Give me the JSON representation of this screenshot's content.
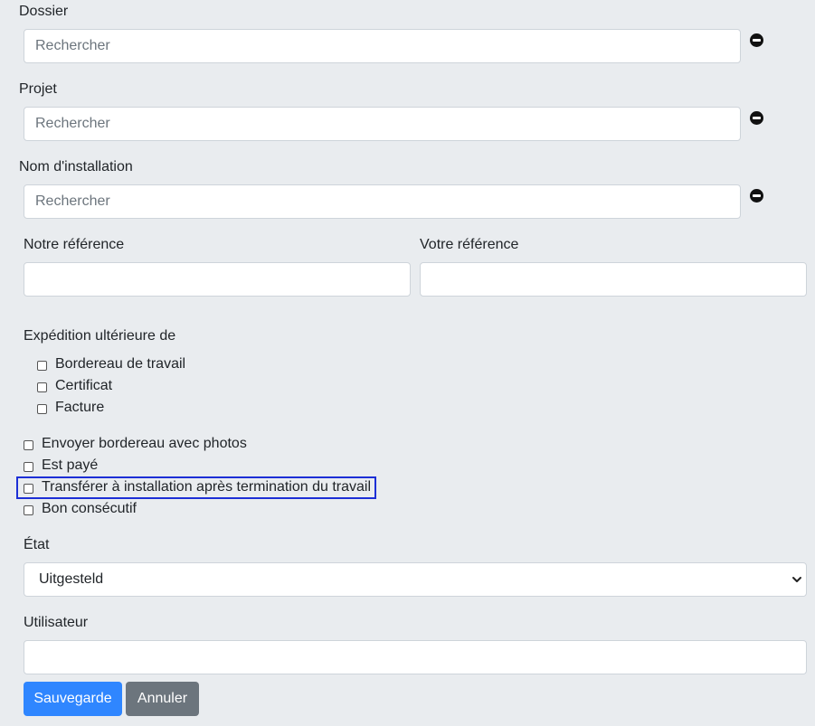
{
  "fields": {
    "dossier": {
      "label": "Dossier",
      "placeholder": "Rechercher"
    },
    "projet": {
      "label": "Projet",
      "placeholder": "Rechercher"
    },
    "installation": {
      "label": "Nom d'installation",
      "placeholder": "Rechercher"
    },
    "notre_ref": {
      "label": "Notre référence",
      "value": ""
    },
    "votre_ref": {
      "label": "Votre référence",
      "value": ""
    },
    "utilisateur": {
      "label": "Utilisateur",
      "value": ""
    }
  },
  "expedition": {
    "label": "Expédition ultérieure de",
    "options": [
      "Bordereau de travail",
      "Certificat",
      "Facture"
    ]
  },
  "checkboxes": [
    "Envoyer bordereau avec photos",
    "Est payé",
    "Transférer à installation après termination du travail",
    "Bon consécutif"
  ],
  "etat": {
    "label": "État",
    "selected": "Uitgesteld"
  },
  "buttons": {
    "save": "Sauvegarde",
    "cancel": "Annuler"
  },
  "colors": {
    "primary": "#2f86ff",
    "secondary": "#6c757d",
    "highlight": "#1c2fd6",
    "background": "#e9ecef"
  }
}
